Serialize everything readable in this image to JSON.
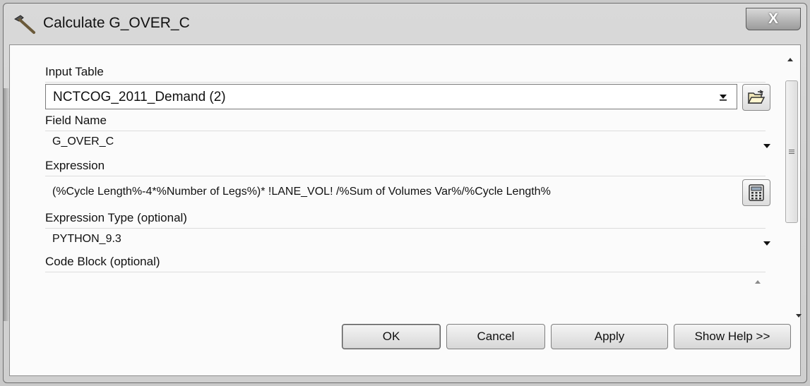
{
  "window": {
    "title": "Calculate G_OVER_C",
    "close_label": "X"
  },
  "form": {
    "input_table": {
      "label": "Input Table",
      "value": "NCTCOG_2011_Demand (2)"
    },
    "field_name": {
      "label": "Field Name",
      "value": "G_OVER_C"
    },
    "expression": {
      "label": "Expression",
      "value": "(%Cycle Length%-4*%Number of Legs%)* !LANE_VOL! /%Sum of Volumes Var%/%Cycle Length%"
    },
    "expression_type": {
      "label": "Expression Type (optional)",
      "value": "PYTHON_9.3"
    },
    "code_block": {
      "label": "Code Block (optional)",
      "value": ""
    }
  },
  "buttons": {
    "ok": "OK",
    "cancel": "Cancel",
    "apply": "Apply",
    "show_help": "Show Help >>"
  },
  "icons": {
    "title": "hammer-icon",
    "browse": "folder-open-icon",
    "calculator": "calculator-icon"
  },
  "colors": {
    "window_bg": "#cfcfcf",
    "client_bg": "#fbfbfb"
  }
}
